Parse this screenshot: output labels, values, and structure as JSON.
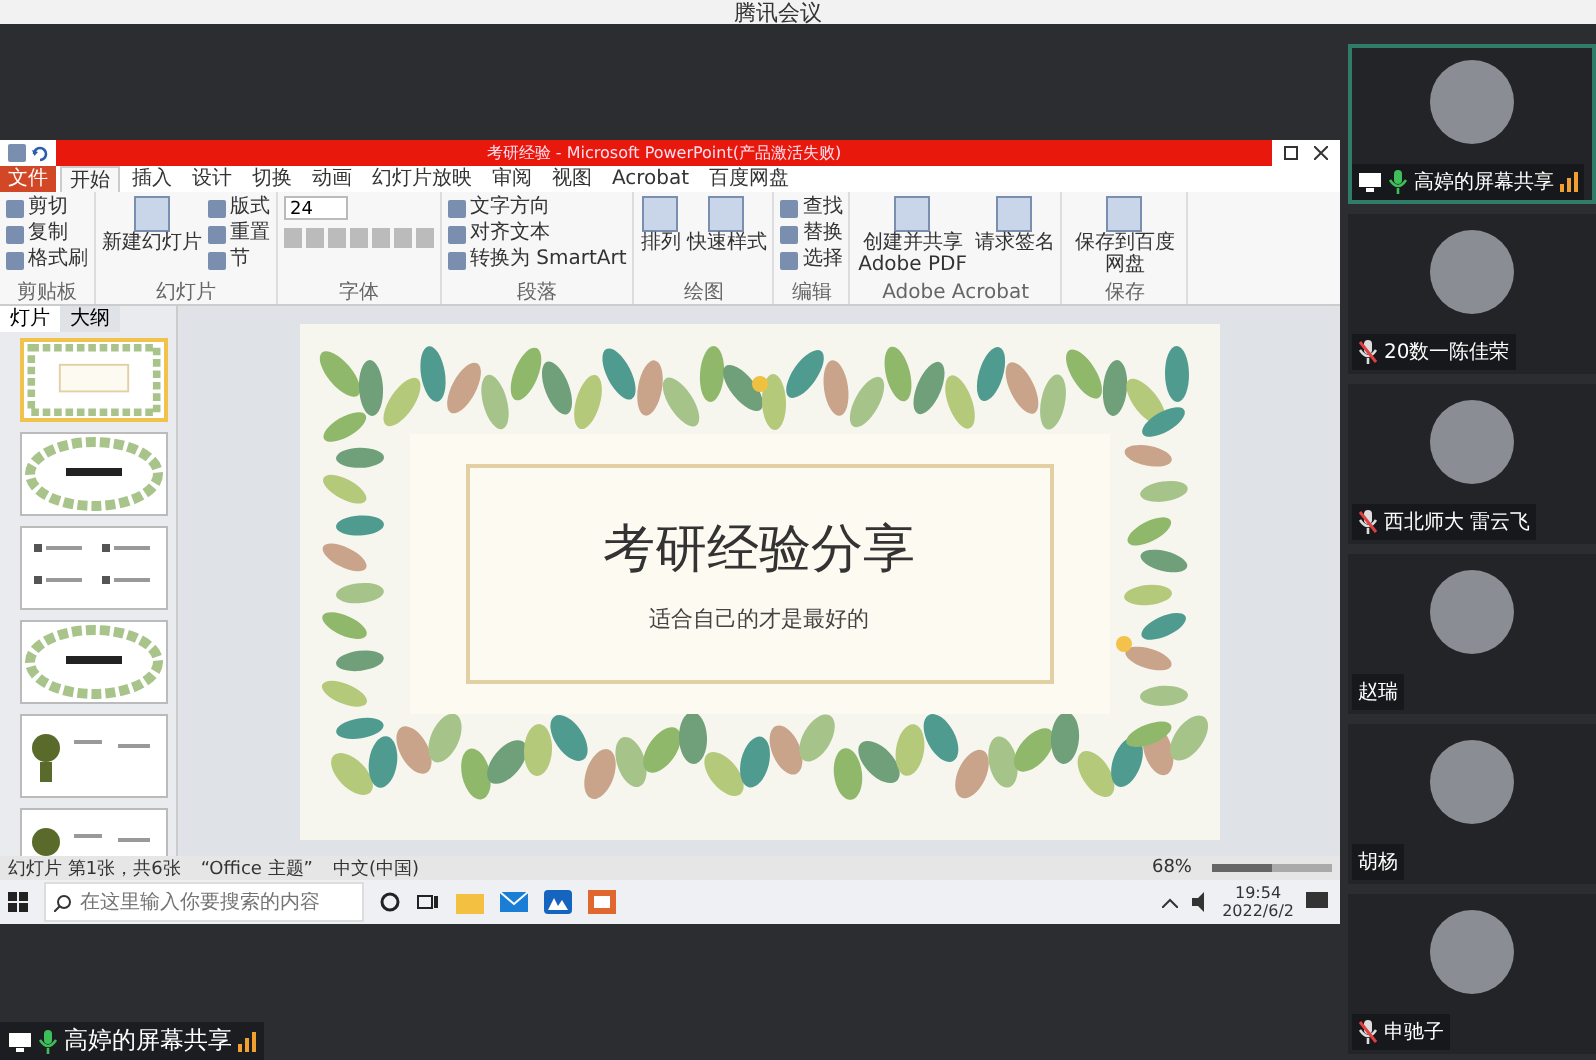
{
  "window": {
    "title": "腾讯会议"
  },
  "shared_screen": {
    "ppt": {
      "title": "考研经验 - Microsoft PowerPoint(产品激活失败)",
      "tabs": [
        {
          "label": "文件",
          "selected": false,
          "kind": "file"
        },
        {
          "label": "开始",
          "selected": true,
          "kind": "tab"
        },
        {
          "label": "插入",
          "selected": false,
          "kind": "tab"
        },
        {
          "label": "设计",
          "selected": false,
          "kind": "tab"
        },
        {
          "label": "切换",
          "selected": false,
          "kind": "tab"
        },
        {
          "label": "动画",
          "selected": false,
          "kind": "tab"
        },
        {
          "label": "幻灯片放映",
          "selected": false,
          "kind": "tab"
        },
        {
          "label": "审阅",
          "selected": false,
          "kind": "tab"
        },
        {
          "label": "视图",
          "selected": false,
          "kind": "tab"
        },
        {
          "label": "Acrobat",
          "selected": false,
          "kind": "tab"
        },
        {
          "label": "百度网盘",
          "selected": false,
          "kind": "tab"
        }
      ],
      "ribbon_groups": [
        {
          "label": "剪贴板",
          "buttons": [
            {
              "label": "剪切",
              "kind": "small"
            },
            {
              "label": "复制",
              "kind": "small"
            },
            {
              "label": "格式刷",
              "kind": "small"
            }
          ]
        },
        {
          "label": "幻灯片",
          "buttons": [
            {
              "label": "新建幻灯片",
              "kind": "large"
            },
            {
              "label": "版式",
              "kind": "small"
            },
            {
              "label": "重置",
              "kind": "small"
            },
            {
              "label": "节",
              "kind": "small"
            }
          ]
        },
        {
          "label": "字体",
          "font_size": "24"
        },
        {
          "label": "段落",
          "buttons": [
            {
              "label": "文字方向",
              "kind": "small"
            },
            {
              "label": "对齐文本",
              "kind": "small"
            },
            {
              "label": "转换为 SmartArt",
              "kind": "small"
            }
          ]
        },
        {
          "label": "绘图",
          "buttons": [
            {
              "label": "排列",
              "kind": "large"
            },
            {
              "label": "快速样式",
              "kind": "large"
            }
          ]
        },
        {
          "label": "编辑",
          "buttons": [
            {
              "label": "查找",
              "kind": "small"
            },
            {
              "label": "替换",
              "kind": "small"
            },
            {
              "label": "选择",
              "kind": "small"
            }
          ]
        },
        {
          "label": "Adobe Acrobat",
          "buttons": [
            {
              "label": "创建并共享 Adobe PDF",
              "kind": "large"
            },
            {
              "label": "请求签名",
              "kind": "large"
            }
          ]
        },
        {
          "label": "保存",
          "buttons": [
            {
              "label": "保存到百度网盘",
              "kind": "large"
            }
          ]
        }
      ],
      "panel_tabs": [
        {
          "label": "灯片",
          "selected": true
        },
        {
          "label": "大纲",
          "selected": false
        }
      ],
      "thumbnails": [
        {
          "kind": "wreath",
          "selected": true
        },
        {
          "kind": "banner",
          "selected": false
        },
        {
          "kind": "list",
          "selected": false
        },
        {
          "kind": "banner",
          "selected": false
        },
        {
          "kind": "illustration",
          "selected": false
        },
        {
          "kind": "illustration",
          "selected": false
        }
      ],
      "slide": {
        "title": "考研经验分享",
        "subtitle": "适合自己的才是最好的"
      },
      "status_bar": {
        "slide_info": "幻灯片 第1张，共6张",
        "theme": "“Office 主题”",
        "language": "中文(中国)",
        "zoom": "68%",
        "level": 0.5
      }
    },
    "taskbar": {
      "search_placeholder": "在这里输入你要搜索的内容",
      "time": "19:54",
      "date": "2022/6/2"
    }
  },
  "sharing_label": {
    "name": "高婷的屏幕共享"
  },
  "participants": [
    {
      "name": "高婷的屏幕共享",
      "mic_on": true,
      "muted": false,
      "sharing": true,
      "speaking": true
    },
    {
      "name": "20数一陈佳荣",
      "mic_on": false,
      "muted": true,
      "sharing": false,
      "speaking": false
    },
    {
      "name": "西北师大 雷云飞",
      "mic_on": false,
      "muted": true,
      "sharing": false,
      "speaking": false
    },
    {
      "name": "赵瑞",
      "mic_on": false,
      "muted": false,
      "sharing": false,
      "speaking": false
    },
    {
      "name": "胡杨",
      "mic_on": false,
      "muted": false,
      "sharing": false,
      "speaking": false
    },
    {
      "name": "申驰子",
      "mic_on": false,
      "muted": true,
      "sharing": false,
      "speaking": false
    }
  ]
}
